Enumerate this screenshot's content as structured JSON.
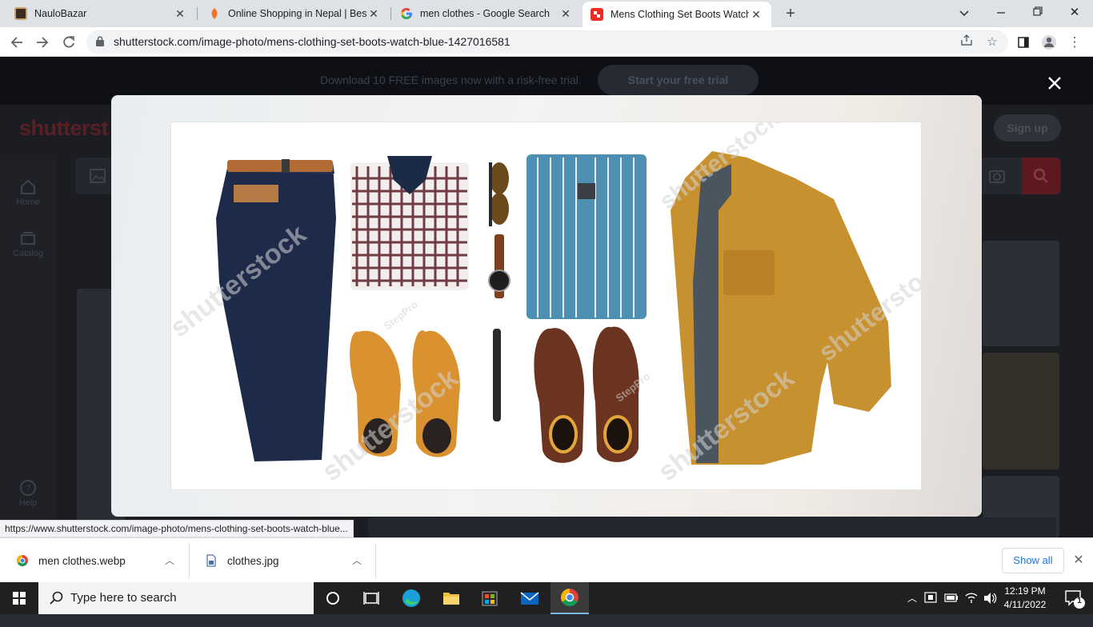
{
  "browser": {
    "tabs": [
      {
        "title": "NauloBazar",
        "active": false
      },
      {
        "title": "Online Shopping in Nepal | Best Price",
        "active": false
      },
      {
        "title": "men clothes - Google Search",
        "active": false
      },
      {
        "title": "Mens Clothing Set Boots Watch Blue",
        "active": true
      }
    ],
    "url": "shutterstock.com/image-photo/mens-clothing-set-boots-watch-blue-1427016581",
    "status_url": "https://www.shutterstock.com/image-photo/mens-clothing-set-boots-watch-blue..."
  },
  "page": {
    "promo_text": "Download 10 FREE images now with a risk-free trial.",
    "promo_button": "Start your free trial",
    "logo": "shutterst",
    "signup": "Sign up",
    "side_home": "Home",
    "side_catalog": "Catalog",
    "side_help": "Help"
  },
  "modal": {
    "watermark": "shutterstock",
    "credit": "StepPro"
  },
  "downloads": {
    "items": [
      {
        "name": "men clothes.webp"
      },
      {
        "name": "clothes.jpg"
      }
    ],
    "show_all": "Show all"
  },
  "taskbar": {
    "search_placeholder": "Type here to search",
    "time": "12:19 PM",
    "date": "4/11/2022",
    "notification_count": "1"
  },
  "colors": {
    "brand": "#ee2b24",
    "chrome_blue": "#1a73e8"
  }
}
